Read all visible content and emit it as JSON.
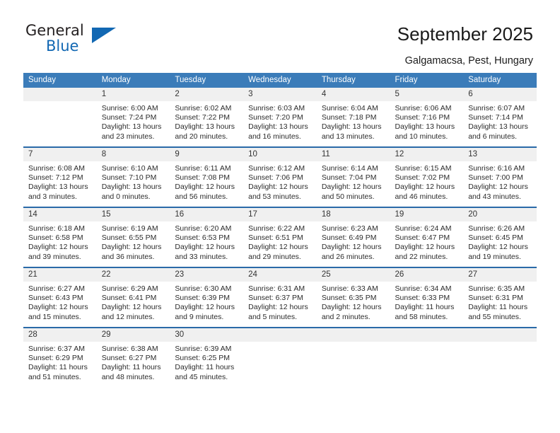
{
  "brand": {
    "name_top": "General",
    "name_bottom": "Blue",
    "accent_color": "#1268b3"
  },
  "header": {
    "title": "September 2025",
    "subtitle": "Galgamacsa, Pest, Hungary"
  },
  "calendar": {
    "header_bg": "#3b7cb9",
    "row_divider_color": "#2a6aa8",
    "datenum_bg": "#f0f0f0",
    "weekday_headers": [
      "Sunday",
      "Monday",
      "Tuesday",
      "Wednesday",
      "Thursday",
      "Friday",
      "Saturday"
    ],
    "weeks": [
      [
        {
          "day": "",
          "sunrise": "",
          "sunset": "",
          "daylight_1": "",
          "daylight_2": ""
        },
        {
          "day": "1",
          "sunrise": "Sunrise: 6:00 AM",
          "sunset": "Sunset: 7:24 PM",
          "daylight_1": "Daylight: 13 hours",
          "daylight_2": "and 23 minutes."
        },
        {
          "day": "2",
          "sunrise": "Sunrise: 6:02 AM",
          "sunset": "Sunset: 7:22 PM",
          "daylight_1": "Daylight: 13 hours",
          "daylight_2": "and 20 minutes."
        },
        {
          "day": "3",
          "sunrise": "Sunrise: 6:03 AM",
          "sunset": "Sunset: 7:20 PM",
          "daylight_1": "Daylight: 13 hours",
          "daylight_2": "and 16 minutes."
        },
        {
          "day": "4",
          "sunrise": "Sunrise: 6:04 AM",
          "sunset": "Sunset: 7:18 PM",
          "daylight_1": "Daylight: 13 hours",
          "daylight_2": "and 13 minutes."
        },
        {
          "day": "5",
          "sunrise": "Sunrise: 6:06 AM",
          "sunset": "Sunset: 7:16 PM",
          "daylight_1": "Daylight: 13 hours",
          "daylight_2": "and 10 minutes."
        },
        {
          "day": "6",
          "sunrise": "Sunrise: 6:07 AM",
          "sunset": "Sunset: 7:14 PM",
          "daylight_1": "Daylight: 13 hours",
          "daylight_2": "and 6 minutes."
        }
      ],
      [
        {
          "day": "7",
          "sunrise": "Sunrise: 6:08 AM",
          "sunset": "Sunset: 7:12 PM",
          "daylight_1": "Daylight: 13 hours",
          "daylight_2": "and 3 minutes."
        },
        {
          "day": "8",
          "sunrise": "Sunrise: 6:10 AM",
          "sunset": "Sunset: 7:10 PM",
          "daylight_1": "Daylight: 13 hours",
          "daylight_2": "and 0 minutes."
        },
        {
          "day": "9",
          "sunrise": "Sunrise: 6:11 AM",
          "sunset": "Sunset: 7:08 PM",
          "daylight_1": "Daylight: 12 hours",
          "daylight_2": "and 56 minutes."
        },
        {
          "day": "10",
          "sunrise": "Sunrise: 6:12 AM",
          "sunset": "Sunset: 7:06 PM",
          "daylight_1": "Daylight: 12 hours",
          "daylight_2": "and 53 minutes."
        },
        {
          "day": "11",
          "sunrise": "Sunrise: 6:14 AM",
          "sunset": "Sunset: 7:04 PM",
          "daylight_1": "Daylight: 12 hours",
          "daylight_2": "and 50 minutes."
        },
        {
          "day": "12",
          "sunrise": "Sunrise: 6:15 AM",
          "sunset": "Sunset: 7:02 PM",
          "daylight_1": "Daylight: 12 hours",
          "daylight_2": "and 46 minutes."
        },
        {
          "day": "13",
          "sunrise": "Sunrise: 6:16 AM",
          "sunset": "Sunset: 7:00 PM",
          "daylight_1": "Daylight: 12 hours",
          "daylight_2": "and 43 minutes."
        }
      ],
      [
        {
          "day": "14",
          "sunrise": "Sunrise: 6:18 AM",
          "sunset": "Sunset: 6:58 PM",
          "daylight_1": "Daylight: 12 hours",
          "daylight_2": "and 39 minutes."
        },
        {
          "day": "15",
          "sunrise": "Sunrise: 6:19 AM",
          "sunset": "Sunset: 6:55 PM",
          "daylight_1": "Daylight: 12 hours",
          "daylight_2": "and 36 minutes."
        },
        {
          "day": "16",
          "sunrise": "Sunrise: 6:20 AM",
          "sunset": "Sunset: 6:53 PM",
          "daylight_1": "Daylight: 12 hours",
          "daylight_2": "and 33 minutes."
        },
        {
          "day": "17",
          "sunrise": "Sunrise: 6:22 AM",
          "sunset": "Sunset: 6:51 PM",
          "daylight_1": "Daylight: 12 hours",
          "daylight_2": "and 29 minutes."
        },
        {
          "day": "18",
          "sunrise": "Sunrise: 6:23 AM",
          "sunset": "Sunset: 6:49 PM",
          "daylight_1": "Daylight: 12 hours",
          "daylight_2": "and 26 minutes."
        },
        {
          "day": "19",
          "sunrise": "Sunrise: 6:24 AM",
          "sunset": "Sunset: 6:47 PM",
          "daylight_1": "Daylight: 12 hours",
          "daylight_2": "and 22 minutes."
        },
        {
          "day": "20",
          "sunrise": "Sunrise: 6:26 AM",
          "sunset": "Sunset: 6:45 PM",
          "daylight_1": "Daylight: 12 hours",
          "daylight_2": "and 19 minutes."
        }
      ],
      [
        {
          "day": "21",
          "sunrise": "Sunrise: 6:27 AM",
          "sunset": "Sunset: 6:43 PM",
          "daylight_1": "Daylight: 12 hours",
          "daylight_2": "and 15 minutes."
        },
        {
          "day": "22",
          "sunrise": "Sunrise: 6:29 AM",
          "sunset": "Sunset: 6:41 PM",
          "daylight_1": "Daylight: 12 hours",
          "daylight_2": "and 12 minutes."
        },
        {
          "day": "23",
          "sunrise": "Sunrise: 6:30 AM",
          "sunset": "Sunset: 6:39 PM",
          "daylight_1": "Daylight: 12 hours",
          "daylight_2": "and 9 minutes."
        },
        {
          "day": "24",
          "sunrise": "Sunrise: 6:31 AM",
          "sunset": "Sunset: 6:37 PM",
          "daylight_1": "Daylight: 12 hours",
          "daylight_2": "and 5 minutes."
        },
        {
          "day": "25",
          "sunrise": "Sunrise: 6:33 AM",
          "sunset": "Sunset: 6:35 PM",
          "daylight_1": "Daylight: 12 hours",
          "daylight_2": "and 2 minutes."
        },
        {
          "day": "26",
          "sunrise": "Sunrise: 6:34 AM",
          "sunset": "Sunset: 6:33 PM",
          "daylight_1": "Daylight: 11 hours",
          "daylight_2": "and 58 minutes."
        },
        {
          "day": "27",
          "sunrise": "Sunrise: 6:35 AM",
          "sunset": "Sunset: 6:31 PM",
          "daylight_1": "Daylight: 11 hours",
          "daylight_2": "and 55 minutes."
        }
      ],
      [
        {
          "day": "28",
          "sunrise": "Sunrise: 6:37 AM",
          "sunset": "Sunset: 6:29 PM",
          "daylight_1": "Daylight: 11 hours",
          "daylight_2": "and 51 minutes."
        },
        {
          "day": "29",
          "sunrise": "Sunrise: 6:38 AM",
          "sunset": "Sunset: 6:27 PM",
          "daylight_1": "Daylight: 11 hours",
          "daylight_2": "and 48 minutes."
        },
        {
          "day": "30",
          "sunrise": "Sunrise: 6:39 AM",
          "sunset": "Sunset: 6:25 PM",
          "daylight_1": "Daylight: 11 hours",
          "daylight_2": "and 45 minutes."
        },
        {
          "day": "",
          "sunrise": "",
          "sunset": "",
          "daylight_1": "",
          "daylight_2": ""
        },
        {
          "day": "",
          "sunrise": "",
          "sunset": "",
          "daylight_1": "",
          "daylight_2": ""
        },
        {
          "day": "",
          "sunrise": "",
          "sunset": "",
          "daylight_1": "",
          "daylight_2": ""
        },
        {
          "day": "",
          "sunrise": "",
          "sunset": "",
          "daylight_1": "",
          "daylight_2": ""
        }
      ]
    ]
  }
}
